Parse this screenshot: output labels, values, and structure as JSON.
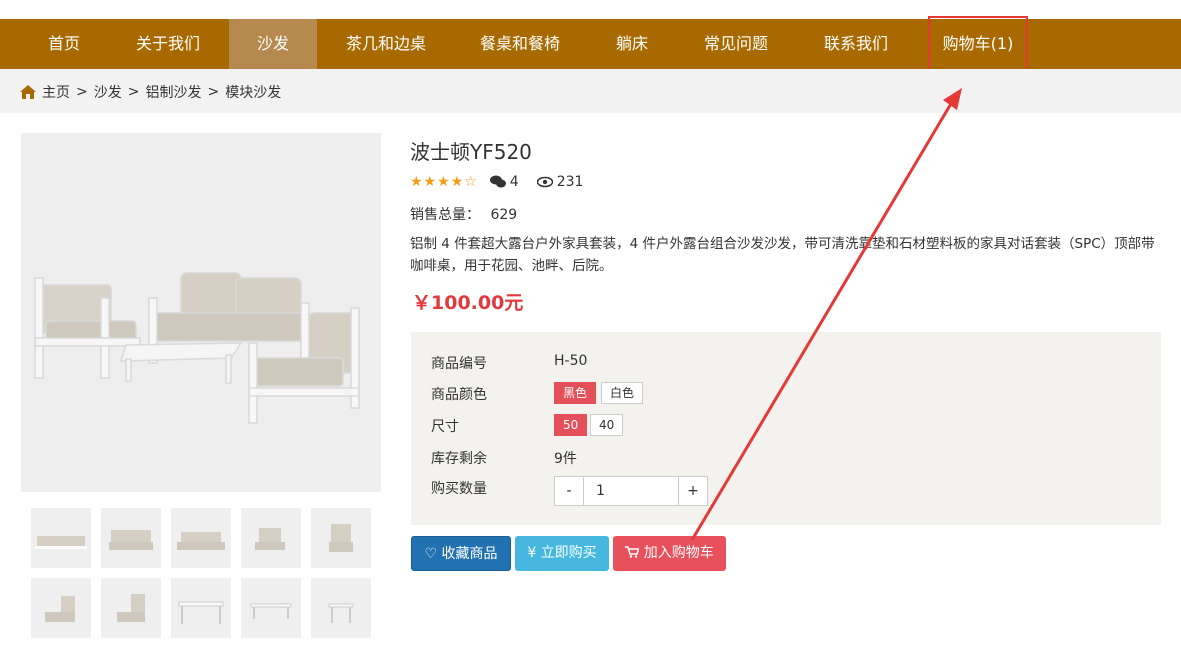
{
  "nav": {
    "items": [
      {
        "label": "首页"
      },
      {
        "label": "关于我们"
      },
      {
        "label": "沙发"
      },
      {
        "label": "茶几和边桌"
      },
      {
        "label": "餐桌和餐椅"
      },
      {
        "label": "躺床"
      },
      {
        "label": "常见问题"
      },
      {
        "label": "联系我们"
      },
      {
        "label": "购物车(1)"
      }
    ]
  },
  "breadcrumb": {
    "home": "主页",
    "sep": ">",
    "c1": "沙发",
    "c2": "铝制沙发",
    "c3": "模块沙发"
  },
  "product": {
    "title": "波士顿YF520",
    "stars": "★★★★☆",
    "comments": "4",
    "views": "231",
    "sales_label": "销售总量：",
    "sales_value": "629",
    "description": "铝制 4 件套超大露台户外家具套装，4 件户外露台组合沙发沙发，带可清洗靠垫和石材塑料板的家具对话套装（SPC）顶部带咖啡桌，用于花园、池畔、后院。",
    "price": "￥100.00元"
  },
  "specs": {
    "code_label": "商品编号",
    "code_value": "H-50",
    "color_label": "商品颜色",
    "color_options": [
      "黑色",
      "白色"
    ],
    "size_label": "尺寸",
    "size_options": [
      "50",
      "40"
    ],
    "stock_label": "库存剩余",
    "stock_value": "9件",
    "qty_label": "购买数量",
    "qty_minus": "-",
    "qty_value": "1",
    "qty_plus": "+"
  },
  "actions": {
    "favorite": "收藏商品",
    "buy_now": "立即购买",
    "add_cart": "加入购物车"
  },
  "colors": {
    "nav_bg": "#a86a00",
    "nav_active": "#b68a4e",
    "price": "#e4393c",
    "selected_option": "#e4505a",
    "annotation": "#e53935"
  }
}
